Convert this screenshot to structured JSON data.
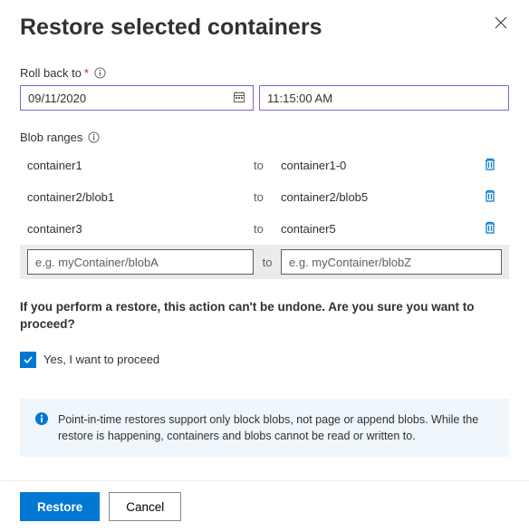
{
  "header": {
    "title": "Restore selected containers"
  },
  "rollback": {
    "label": "Roll back to",
    "date": "09/11/2020",
    "time": "11:15:00 AM"
  },
  "ranges": {
    "label": "Blob ranges",
    "to_word": "to",
    "rows": [
      {
        "from": "container1",
        "to": "container1-0"
      },
      {
        "from": "container2/blob1",
        "to": "container2/blob5"
      },
      {
        "from": "container3",
        "to": "container5"
      }
    ],
    "input": {
      "from_placeholder": "e.g. myContainer/blobA",
      "to_placeholder": "e.g. myContainer/blobZ"
    }
  },
  "warning_text": "If you perform a restore, this action can't be undone. Are you sure you want to proceed?",
  "confirm": {
    "label": "Yes, I want to proceed",
    "checked": true
  },
  "info_text": "Point-in-time restores support only block blobs, not page or append blobs. While the restore is happening, containers and blobs cannot be read or written to.",
  "footer": {
    "restore": "Restore",
    "cancel": "Cancel"
  }
}
